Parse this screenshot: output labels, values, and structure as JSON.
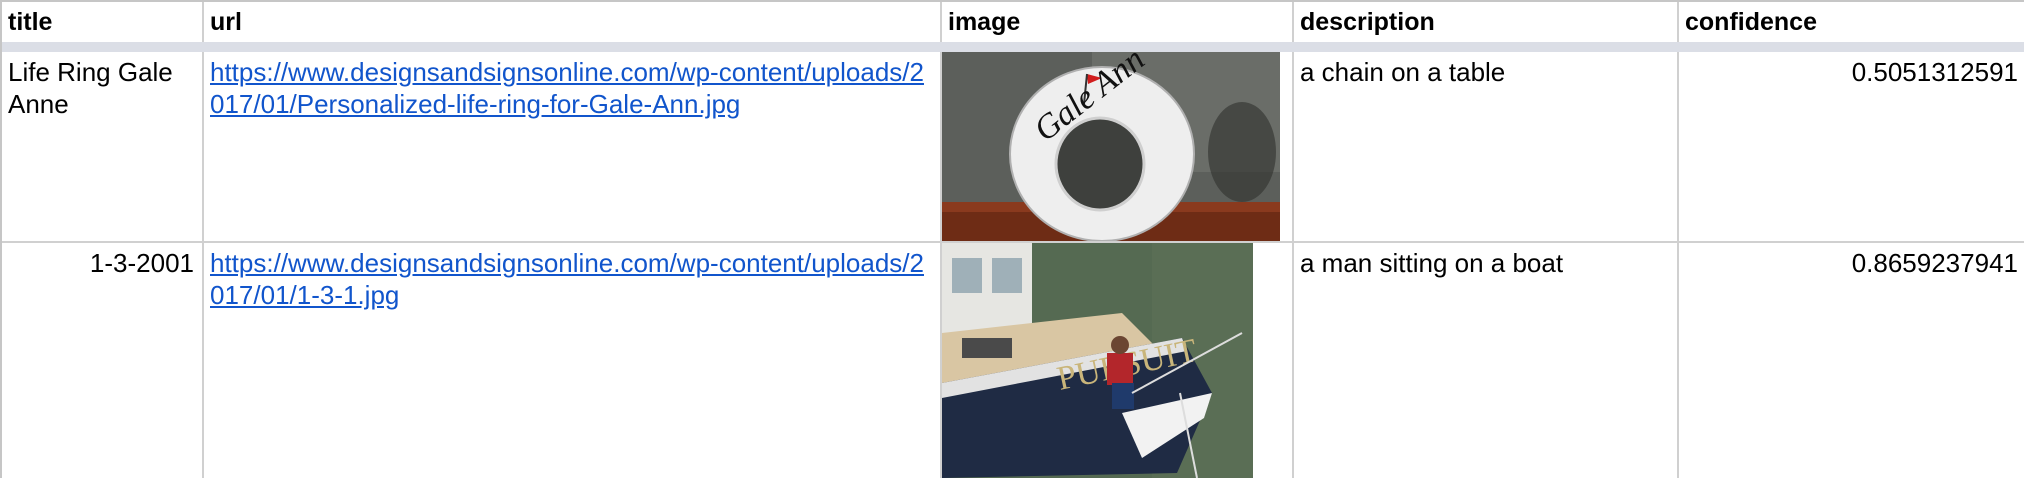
{
  "columns": {
    "title": "title",
    "url": "url",
    "image": "image",
    "description": "description",
    "confidence": "confidence"
  },
  "rows": [
    {
      "title": "Life Ring Gale Anne",
      "url": "https://www.designsandsignsonline.com/wp-content/uploads/2017/01/Personalized-life-ring-for-Gale-Ann.jpg",
      "image_text": "Gale Ann",
      "description": "a chain on a table",
      "confidence": "0.5051312591"
    },
    {
      "title": "1-3-2001",
      "url": "https://www.designsandsignsonline.com/wp-content/uploads/2017/01/1-3-1.jpg",
      "image_text": "PURSUIT",
      "description": "a man sitting on a boat",
      "confidence": "0.8659237941"
    }
  ],
  "colors": {
    "link": "#1155cc",
    "gridline": "#d0d0d0",
    "header_separator": "#dbdee6"
  }
}
